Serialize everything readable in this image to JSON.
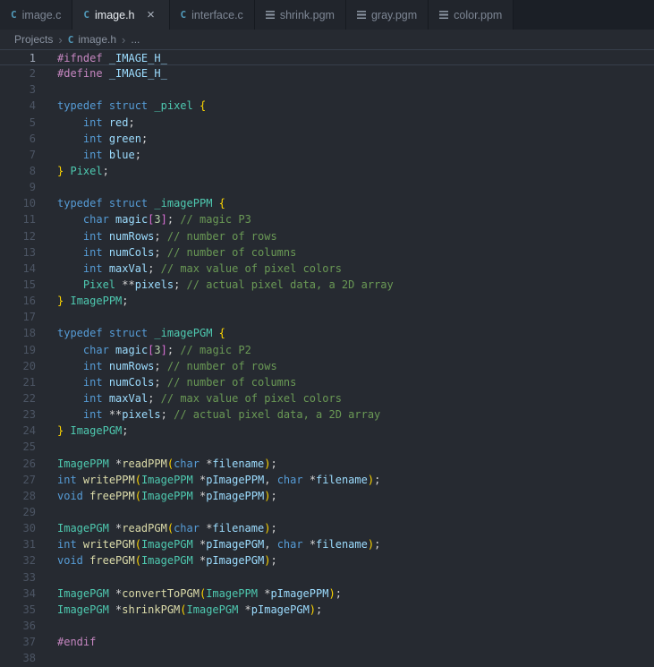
{
  "icons": {
    "c_glyph": "C",
    "close_glyph": "×",
    "chevron": "›"
  },
  "colors": {
    "editor_bg": "#262a31",
    "tabbar_bg": "#1b1f26",
    "inactive_tab_bg": "#21252c",
    "c_icon": "#519aba",
    "keyword": "#569cd6",
    "preprocessor": "#c586c0",
    "type": "#4ec9b0",
    "variable": "#9cdcfe",
    "function": "#dcdcaa",
    "comment": "#6a9955",
    "bracket": "#ffd700"
  },
  "tabs": [
    {
      "label": "image.c",
      "icon": "c",
      "active": false
    },
    {
      "label": "image.h",
      "icon": "c",
      "active": true
    },
    {
      "label": "interface.c",
      "icon": "c",
      "active": false
    },
    {
      "label": "shrink.pgm",
      "icon": "text",
      "active": false
    },
    {
      "label": "gray.pgm",
      "icon": "text",
      "active": false
    },
    {
      "label": "color.ppm",
      "icon": "text",
      "active": false
    }
  ],
  "breadcrumb": {
    "root": "Projects",
    "file": "image.h",
    "tail": "..."
  },
  "editor": {
    "current_line": 1,
    "lines": [
      {
        "n": 1,
        "t": [
          [
            "pre",
            "#ifndef"
          ],
          [
            "pl",
            " "
          ],
          [
            "va",
            "_IMAGE_H_"
          ]
        ]
      },
      {
        "n": 2,
        "t": [
          [
            "pre",
            "#define"
          ],
          [
            "pl",
            " "
          ],
          [
            "va",
            "_IMAGE_H_"
          ]
        ]
      },
      {
        "n": 3,
        "t": []
      },
      {
        "n": 4,
        "t": [
          [
            "kw",
            "typedef"
          ],
          [
            "pl",
            " "
          ],
          [
            "kw",
            "struct"
          ],
          [
            "pl",
            " "
          ],
          [
            "ty",
            "_pixel"
          ],
          [
            "pl",
            " "
          ],
          [
            "b1",
            "{"
          ]
        ]
      },
      {
        "n": 5,
        "t": [
          [
            "pl",
            "    "
          ],
          [
            "kw",
            "int"
          ],
          [
            "pl",
            " "
          ],
          [
            "va",
            "red"
          ],
          [
            "pl",
            ";"
          ]
        ]
      },
      {
        "n": 6,
        "t": [
          [
            "pl",
            "    "
          ],
          [
            "kw",
            "int"
          ],
          [
            "pl",
            " "
          ],
          [
            "va",
            "green"
          ],
          [
            "pl",
            ";"
          ]
        ]
      },
      {
        "n": 7,
        "t": [
          [
            "pl",
            "    "
          ],
          [
            "kw",
            "int"
          ],
          [
            "pl",
            " "
          ],
          [
            "va",
            "blue"
          ],
          [
            "pl",
            ";"
          ]
        ]
      },
      {
        "n": 8,
        "t": [
          [
            "b1",
            "}"
          ],
          [
            "pl",
            " "
          ],
          [
            "ty",
            "Pixel"
          ],
          [
            "pl",
            ";"
          ]
        ]
      },
      {
        "n": 9,
        "t": []
      },
      {
        "n": 10,
        "t": [
          [
            "kw",
            "typedef"
          ],
          [
            "pl",
            " "
          ],
          [
            "kw",
            "struct"
          ],
          [
            "pl",
            " "
          ],
          [
            "ty",
            "_imagePPM"
          ],
          [
            "pl",
            " "
          ],
          [
            "b1",
            "{"
          ]
        ]
      },
      {
        "n": 11,
        "t": [
          [
            "pl",
            "    "
          ],
          [
            "kw",
            "char"
          ],
          [
            "pl",
            " "
          ],
          [
            "va",
            "magic"
          ],
          [
            "b2",
            "["
          ],
          [
            "nu",
            "3"
          ],
          [
            "b2",
            "]"
          ],
          [
            "pl",
            "; "
          ],
          [
            "co",
            "// magic P3"
          ]
        ]
      },
      {
        "n": 12,
        "t": [
          [
            "pl",
            "    "
          ],
          [
            "kw",
            "int"
          ],
          [
            "pl",
            " "
          ],
          [
            "va",
            "numRows"
          ],
          [
            "pl",
            "; "
          ],
          [
            "co",
            "// number of rows"
          ]
        ]
      },
      {
        "n": 13,
        "t": [
          [
            "pl",
            "    "
          ],
          [
            "kw",
            "int"
          ],
          [
            "pl",
            " "
          ],
          [
            "va",
            "numCols"
          ],
          [
            "pl",
            "; "
          ],
          [
            "co",
            "// number of columns"
          ]
        ]
      },
      {
        "n": 14,
        "t": [
          [
            "pl",
            "    "
          ],
          [
            "kw",
            "int"
          ],
          [
            "pl",
            " "
          ],
          [
            "va",
            "maxVal"
          ],
          [
            "pl",
            "; "
          ],
          [
            "co",
            "// max value of pixel colors"
          ]
        ]
      },
      {
        "n": 15,
        "t": [
          [
            "pl",
            "    "
          ],
          [
            "ty",
            "Pixel"
          ],
          [
            "pl",
            " **"
          ],
          [
            "va",
            "pixels"
          ],
          [
            "pl",
            "; "
          ],
          [
            "co",
            "// actual pixel data, a 2D array"
          ]
        ]
      },
      {
        "n": 16,
        "t": [
          [
            "b1",
            "}"
          ],
          [
            "pl",
            " "
          ],
          [
            "ty",
            "ImagePPM"
          ],
          [
            "pl",
            ";"
          ]
        ]
      },
      {
        "n": 17,
        "t": []
      },
      {
        "n": 18,
        "t": [
          [
            "kw",
            "typedef"
          ],
          [
            "pl",
            " "
          ],
          [
            "kw",
            "struct"
          ],
          [
            "pl",
            " "
          ],
          [
            "ty",
            "_imagePGM"
          ],
          [
            "pl",
            " "
          ],
          [
            "b1",
            "{"
          ]
        ]
      },
      {
        "n": 19,
        "t": [
          [
            "pl",
            "    "
          ],
          [
            "kw",
            "char"
          ],
          [
            "pl",
            " "
          ],
          [
            "va",
            "magic"
          ],
          [
            "b2",
            "["
          ],
          [
            "nu",
            "3"
          ],
          [
            "b2",
            "]"
          ],
          [
            "pl",
            "; "
          ],
          [
            "co",
            "// magic P2"
          ]
        ]
      },
      {
        "n": 20,
        "t": [
          [
            "pl",
            "    "
          ],
          [
            "kw",
            "int"
          ],
          [
            "pl",
            " "
          ],
          [
            "va",
            "numRows"
          ],
          [
            "pl",
            "; "
          ],
          [
            "co",
            "// number of rows"
          ]
        ]
      },
      {
        "n": 21,
        "t": [
          [
            "pl",
            "    "
          ],
          [
            "kw",
            "int"
          ],
          [
            "pl",
            " "
          ],
          [
            "va",
            "numCols"
          ],
          [
            "pl",
            "; "
          ],
          [
            "co",
            "// number of columns"
          ]
        ]
      },
      {
        "n": 22,
        "t": [
          [
            "pl",
            "    "
          ],
          [
            "kw",
            "int"
          ],
          [
            "pl",
            " "
          ],
          [
            "va",
            "maxVal"
          ],
          [
            "pl",
            "; "
          ],
          [
            "co",
            "// max value of pixel colors"
          ]
        ]
      },
      {
        "n": 23,
        "t": [
          [
            "pl",
            "    "
          ],
          [
            "kw",
            "int"
          ],
          [
            "pl",
            " **"
          ],
          [
            "va",
            "pixels"
          ],
          [
            "pl",
            "; "
          ],
          [
            "co",
            "// actual pixel data, a 2D array"
          ]
        ]
      },
      {
        "n": 24,
        "t": [
          [
            "b1",
            "}"
          ],
          [
            "pl",
            " "
          ],
          [
            "ty",
            "ImagePGM"
          ],
          [
            "pl",
            ";"
          ]
        ]
      },
      {
        "n": 25,
        "t": []
      },
      {
        "n": 26,
        "t": [
          [
            "ty",
            "ImagePPM"
          ],
          [
            "pl",
            " *"
          ],
          [
            "fn",
            "readPPM"
          ],
          [
            "b1",
            "("
          ],
          [
            "kw",
            "char"
          ],
          [
            "pl",
            " *"
          ],
          [
            "va",
            "filename"
          ],
          [
            "b1",
            ")"
          ],
          [
            "pl",
            ";"
          ]
        ]
      },
      {
        "n": 27,
        "t": [
          [
            "kw",
            "int"
          ],
          [
            "pl",
            " "
          ],
          [
            "fn",
            "writePPM"
          ],
          [
            "b1",
            "("
          ],
          [
            "ty",
            "ImagePPM"
          ],
          [
            "pl",
            " *"
          ],
          [
            "va",
            "pImagePPM"
          ],
          [
            "pl",
            ", "
          ],
          [
            "kw",
            "char"
          ],
          [
            "pl",
            " *"
          ],
          [
            "va",
            "filename"
          ],
          [
            "b1",
            ")"
          ],
          [
            "pl",
            ";"
          ]
        ]
      },
      {
        "n": 28,
        "t": [
          [
            "kw",
            "void"
          ],
          [
            "pl",
            " "
          ],
          [
            "fn",
            "freePPM"
          ],
          [
            "b1",
            "("
          ],
          [
            "ty",
            "ImagePPM"
          ],
          [
            "pl",
            " *"
          ],
          [
            "va",
            "pImagePPM"
          ],
          [
            "b1",
            ")"
          ],
          [
            "pl",
            ";"
          ]
        ]
      },
      {
        "n": 29,
        "t": []
      },
      {
        "n": 30,
        "t": [
          [
            "ty",
            "ImagePGM"
          ],
          [
            "pl",
            " *"
          ],
          [
            "fn",
            "readPGM"
          ],
          [
            "b1",
            "("
          ],
          [
            "kw",
            "char"
          ],
          [
            "pl",
            " *"
          ],
          [
            "va",
            "filename"
          ],
          [
            "b1",
            ")"
          ],
          [
            "pl",
            ";"
          ]
        ]
      },
      {
        "n": 31,
        "t": [
          [
            "kw",
            "int"
          ],
          [
            "pl",
            " "
          ],
          [
            "fn",
            "writePGM"
          ],
          [
            "b1",
            "("
          ],
          [
            "ty",
            "ImagePGM"
          ],
          [
            "pl",
            " *"
          ],
          [
            "va",
            "pImagePGM"
          ],
          [
            "pl",
            ", "
          ],
          [
            "kw",
            "char"
          ],
          [
            "pl",
            " *"
          ],
          [
            "va",
            "filename"
          ],
          [
            "b1",
            ")"
          ],
          [
            "pl",
            ";"
          ]
        ]
      },
      {
        "n": 32,
        "t": [
          [
            "kw",
            "void"
          ],
          [
            "pl",
            " "
          ],
          [
            "fn",
            "freePGM"
          ],
          [
            "b1",
            "("
          ],
          [
            "ty",
            "ImagePGM"
          ],
          [
            "pl",
            " *"
          ],
          [
            "va",
            "pImagePGM"
          ],
          [
            "b1",
            ")"
          ],
          [
            "pl",
            ";"
          ]
        ]
      },
      {
        "n": 33,
        "t": []
      },
      {
        "n": 34,
        "t": [
          [
            "ty",
            "ImagePGM"
          ],
          [
            "pl",
            " *"
          ],
          [
            "fn",
            "convertToPGM"
          ],
          [
            "b1",
            "("
          ],
          [
            "ty",
            "ImagePPM"
          ],
          [
            "pl",
            " *"
          ],
          [
            "va",
            "pImagePPM"
          ],
          [
            "b1",
            ")"
          ],
          [
            "pl",
            ";"
          ]
        ]
      },
      {
        "n": 35,
        "t": [
          [
            "ty",
            "ImagePGM"
          ],
          [
            "pl",
            " *"
          ],
          [
            "fn",
            "shrinkPGM"
          ],
          [
            "b1",
            "("
          ],
          [
            "ty",
            "ImagePGM"
          ],
          [
            "pl",
            " *"
          ],
          [
            "va",
            "pImagePGM"
          ],
          [
            "b1",
            ")"
          ],
          [
            "pl",
            ";"
          ]
        ]
      },
      {
        "n": 36,
        "t": []
      },
      {
        "n": 37,
        "t": [
          [
            "pre",
            "#endif"
          ]
        ]
      },
      {
        "n": 38,
        "t": []
      }
    ]
  }
}
